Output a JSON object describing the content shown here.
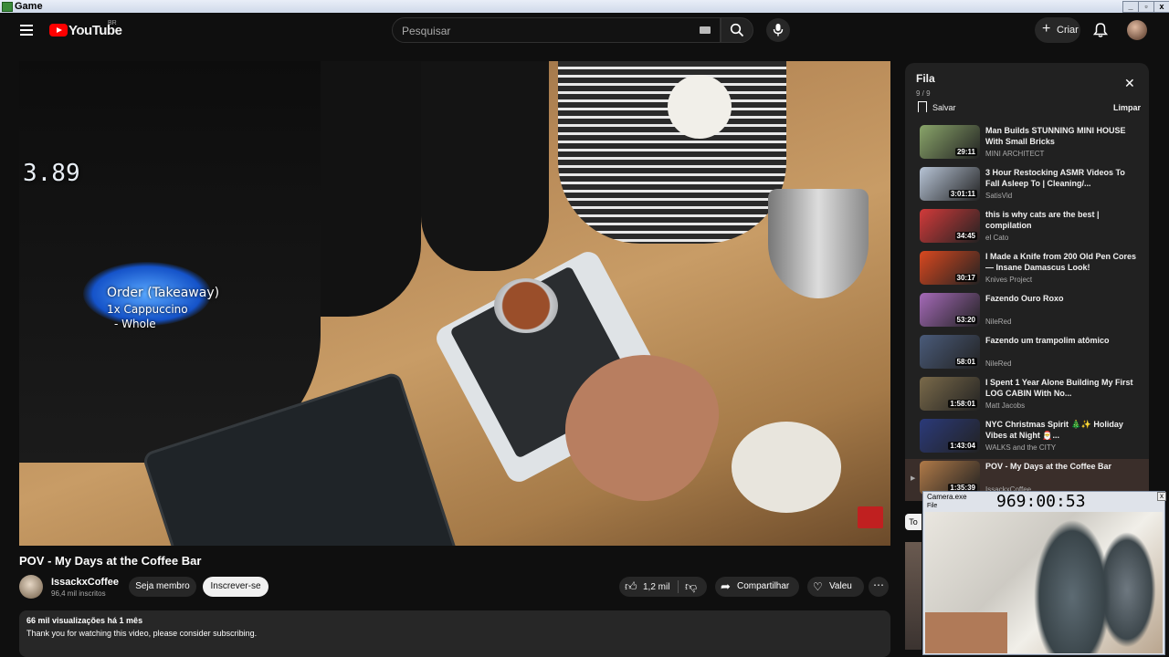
{
  "window": {
    "title": "Game",
    "min": "_",
    "max": "▫",
    "close": "x"
  },
  "header": {
    "logo_text": "YouTube",
    "country": "BR",
    "search_placeholder": "Pesquisar",
    "create_label": "Criar"
  },
  "video": {
    "overlay_title": "Order (Takeaway)",
    "overlay_line1": "1x Cappuccino",
    "overlay_line2": "- Whole",
    "scale_display": "3.89",
    "title": "POV - My Days at the Coffee Bar",
    "channel": "IssackxCoffee",
    "subscribers": "96,4 mil inscritos",
    "member_label": "Seja membro",
    "subscribe_label": "Inscrever-se",
    "likes": "1,2 mil",
    "share_label": "Compartilhar",
    "thanks_label": "Valeu",
    "stats": "66 mil visualizações  há 1 mês",
    "description": "Thank you for watching this video, please consider subscribing."
  },
  "queue": {
    "title": "Fila",
    "count": "9 / 9",
    "save_label": "Salvar",
    "clear_label": "Limpar",
    "items": [
      {
        "title": "Man Builds STUNNING MINI HOUSE With Small Bricks",
        "channel": "MINI ARCHITECT",
        "duration": "29:11",
        "thumb_color": "#8aa56a"
      },
      {
        "title": "3 Hour Restocking ASMR Videos To Fall Asleep To | Cleaning/...",
        "channel": "SatisVid",
        "duration": "3:01:11",
        "thumb_color": "#b7c4d6"
      },
      {
        "title": "this is why cats are the best | compilation",
        "channel": "el Cato",
        "duration": "34:45",
        "thumb_color": "#d23a3a"
      },
      {
        "title": "I Made a Knife from 200 Old Pen Cores — Insane Damascus Look!",
        "channel": "Knives Project",
        "duration": "30:17",
        "thumb_color": "#d9481f"
      },
      {
        "title": "Fazendo Ouro Roxo",
        "channel": "NileRed",
        "duration": "53:20",
        "thumb_color": "#a56ab8"
      },
      {
        "title": "Fazendo um trampolim atômico",
        "channel": "NileRed",
        "duration": "58:01",
        "thumb_color": "#4a5b7a"
      },
      {
        "title": "I Spent 1 Year Alone Building My First LOG CABIN With No...",
        "channel": "Matt Jacobs",
        "duration": "1:58:01",
        "thumb_color": "#7a6a4a"
      },
      {
        "title": "NYC Christmas Spirit 🎄✨ Holiday Vibes at Night 🎅...",
        "channel": "WALKS and the CITY",
        "duration": "1:43:04",
        "thumb_color": "#2b3a7a"
      },
      {
        "title": "POV - My Days at the Coffee Bar",
        "channel": "IssackxCoffee",
        "duration": "1:35:39",
        "thumb_color": "#b07a48"
      }
    ]
  },
  "side": {
    "fragment_label": "To"
  },
  "camera": {
    "title": "Camera.exe",
    "menu": "File",
    "timer": "969:00:53"
  }
}
